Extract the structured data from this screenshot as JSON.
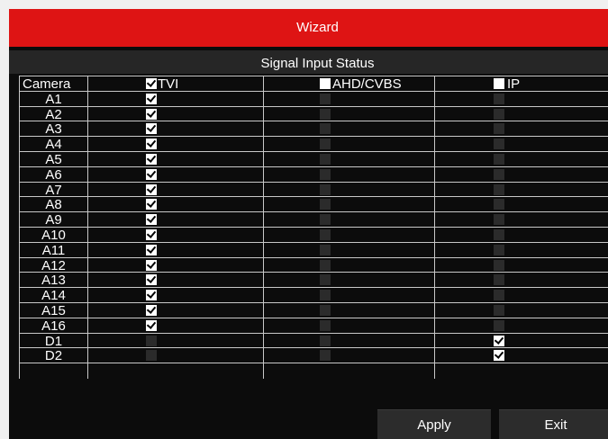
{
  "window": {
    "title": "Wizard"
  },
  "panel": {
    "subtitle": "Signal Input Status"
  },
  "table": {
    "headers": {
      "camera": "Camera",
      "tvi": "TVI",
      "ahd": "AHD/CVBS",
      "ip": "IP"
    },
    "header_checked": {
      "tvi": true,
      "ahd": false,
      "ip": false
    },
    "rows": [
      {
        "name": "A1",
        "tvi": true,
        "ahd": false,
        "ip": false
      },
      {
        "name": "A2",
        "tvi": true,
        "ahd": false,
        "ip": false
      },
      {
        "name": "A3",
        "tvi": true,
        "ahd": false,
        "ip": false
      },
      {
        "name": "A4",
        "tvi": true,
        "ahd": false,
        "ip": false
      },
      {
        "name": "A5",
        "tvi": true,
        "ahd": false,
        "ip": false
      },
      {
        "name": "A6",
        "tvi": true,
        "ahd": false,
        "ip": false
      },
      {
        "name": "A7",
        "tvi": true,
        "ahd": false,
        "ip": false
      },
      {
        "name": "A8",
        "tvi": true,
        "ahd": false,
        "ip": false
      },
      {
        "name": "A9",
        "tvi": true,
        "ahd": false,
        "ip": false
      },
      {
        "name": "A10",
        "tvi": true,
        "ahd": false,
        "ip": false
      },
      {
        "name": "A11",
        "tvi": true,
        "ahd": false,
        "ip": false
      },
      {
        "name": "A12",
        "tvi": true,
        "ahd": false,
        "ip": false
      },
      {
        "name": "A13",
        "tvi": true,
        "ahd": false,
        "ip": false
      },
      {
        "name": "A14",
        "tvi": true,
        "ahd": false,
        "ip": false
      },
      {
        "name": "A15",
        "tvi": true,
        "ahd": false,
        "ip": false
      },
      {
        "name": "A16",
        "tvi": true,
        "ahd": false,
        "ip": false
      },
      {
        "name": "D1",
        "tvi": false,
        "ahd": false,
        "ip": true
      },
      {
        "name": "D2",
        "tvi": false,
        "ahd": false,
        "ip": true
      }
    ]
  },
  "buttons": {
    "apply": "Apply",
    "exit": "Exit"
  },
  "colors": {
    "title_bar": "#de1414",
    "background": "#0c0c0c",
    "grid_line": "#c8c8c8"
  }
}
